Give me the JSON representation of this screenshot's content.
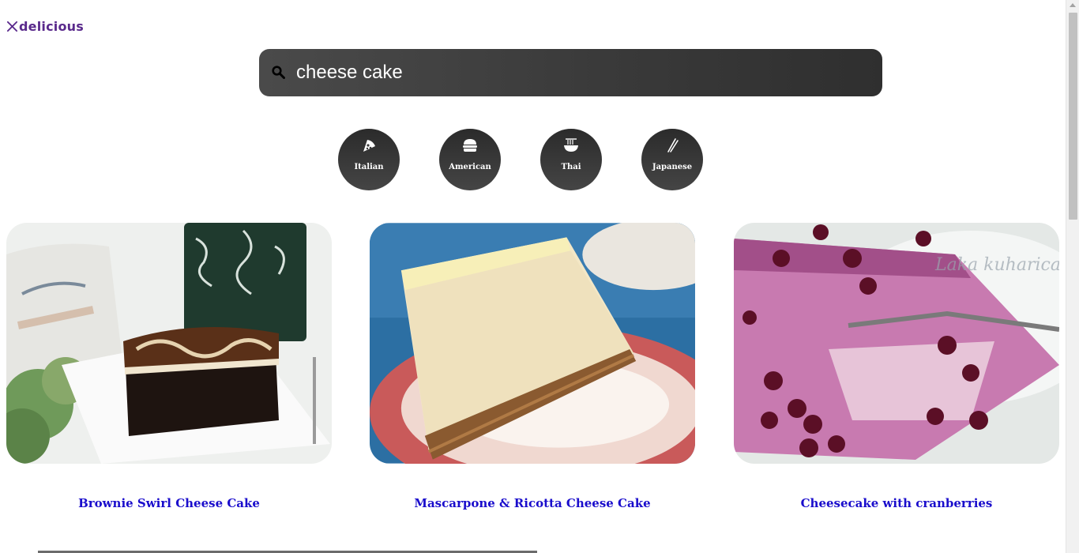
{
  "logo": {
    "text": "delicious",
    "icon": "fork-knife-icon",
    "color": "#5a2a8c"
  },
  "search": {
    "value": "cheese cake",
    "icon": "search-icon"
  },
  "categories": [
    {
      "label": "Italian",
      "icon": "pizza-icon"
    },
    {
      "label": "American",
      "icon": "burger-icon"
    },
    {
      "label": "Thai",
      "icon": "noodle-bowl-icon"
    },
    {
      "label": "Japanese",
      "icon": "chopsticks-icon"
    }
  ],
  "recipes": [
    {
      "title": "Brownie Swirl Cheese Cake"
    },
    {
      "title": "Mascarpone & Ricotta Cheese Cake"
    },
    {
      "title": "Cheesecake with cranberries"
    }
  ],
  "colors": {
    "link": "#1a0dcc",
    "accent": "#5a2a8c",
    "chip": "#3a3a3a"
  }
}
